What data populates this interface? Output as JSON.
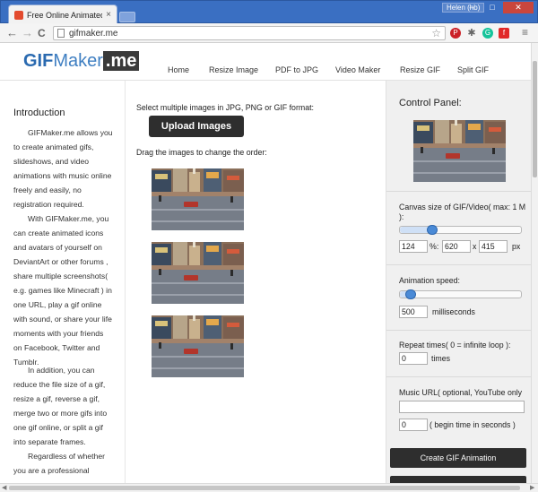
{
  "browser": {
    "tab_title": "Free Online Animated GIF",
    "tab_close": "×",
    "user": "Helen (hb)",
    "url": "gifmaker.me",
    "nav": {
      "back": "←",
      "forward": "→",
      "reload": "C"
    },
    "star": "☆",
    "menu": "≡",
    "win": {
      "minimize": "–",
      "maximize": "□",
      "close": "✕"
    },
    "extensions": [
      "pinterest-icon",
      "puzzle-extension-icon",
      "grammarly-icon",
      "flipboard-icon"
    ]
  },
  "site": {
    "logo": {
      "part1": "GIF",
      "part2": "Maker",
      "part3": ".me"
    },
    "nav": [
      "Home",
      "Resize Image",
      "PDF to JPG",
      "Video Maker",
      "Resize GIF",
      "Split GIF"
    ]
  },
  "sidebar": {
    "title": "Introduction",
    "paragraphs": [
      "GIFMaker.me allows you to create animated gifs, slideshows, and video animations with music online freely and easily, no registration required.",
      "With GIFMaker.me, you can create animated icons and avatars of yourself on DeviantArt or other forums , share multiple screenshots( e.g. games like Minecraft ) in one URL, play a gif online with sound, or share your life moments with your friends on Facebook, Twitter and Tumblr.",
      "In addition, you can reduce the file size of a gif, resize a gif, reverse a gif, merge two or more gifs into one gif online, or split a gif into separate frames.",
      "Regardless of whether you are a professional"
    ]
  },
  "main": {
    "select_text": "Select multiple images in JPG, PNG or GIF format:",
    "upload_label": "Upload Images",
    "drag_text": "Drag the images to change the order:",
    "thumbnail_count": 3
  },
  "control_panel": {
    "title": "Control Panel:",
    "canvas_label": "Canvas size of GIF/Video( max: 1 M ):",
    "canvas_percent": "124",
    "canvas_percent_unit": "%:",
    "canvas_width": "620",
    "canvas_x": "x",
    "canvas_height": "415",
    "canvas_unit": "px",
    "canvas_slider_fraction": 0.27,
    "speed_label": "Animation speed:",
    "speed_value": "500",
    "speed_unit": "milliseconds",
    "speed_slider_fraction": 0.09,
    "repeat_label": "Repeat times( 0 = infinite loop ):",
    "repeat_value": "0",
    "repeat_unit": "times",
    "music_label": "Music URL( optional, YouTube only",
    "music_value": "",
    "begin_value": "0",
    "begin_unit": "( begin time in seconds )",
    "create_label": "Create GIF Animation"
  },
  "colors": {
    "brand_blue": "#2a6ab0",
    "dark_button": "#2e2e2e",
    "panel_bg": "#f0f0f0",
    "chrome_blue": "#3a6fc2"
  }
}
